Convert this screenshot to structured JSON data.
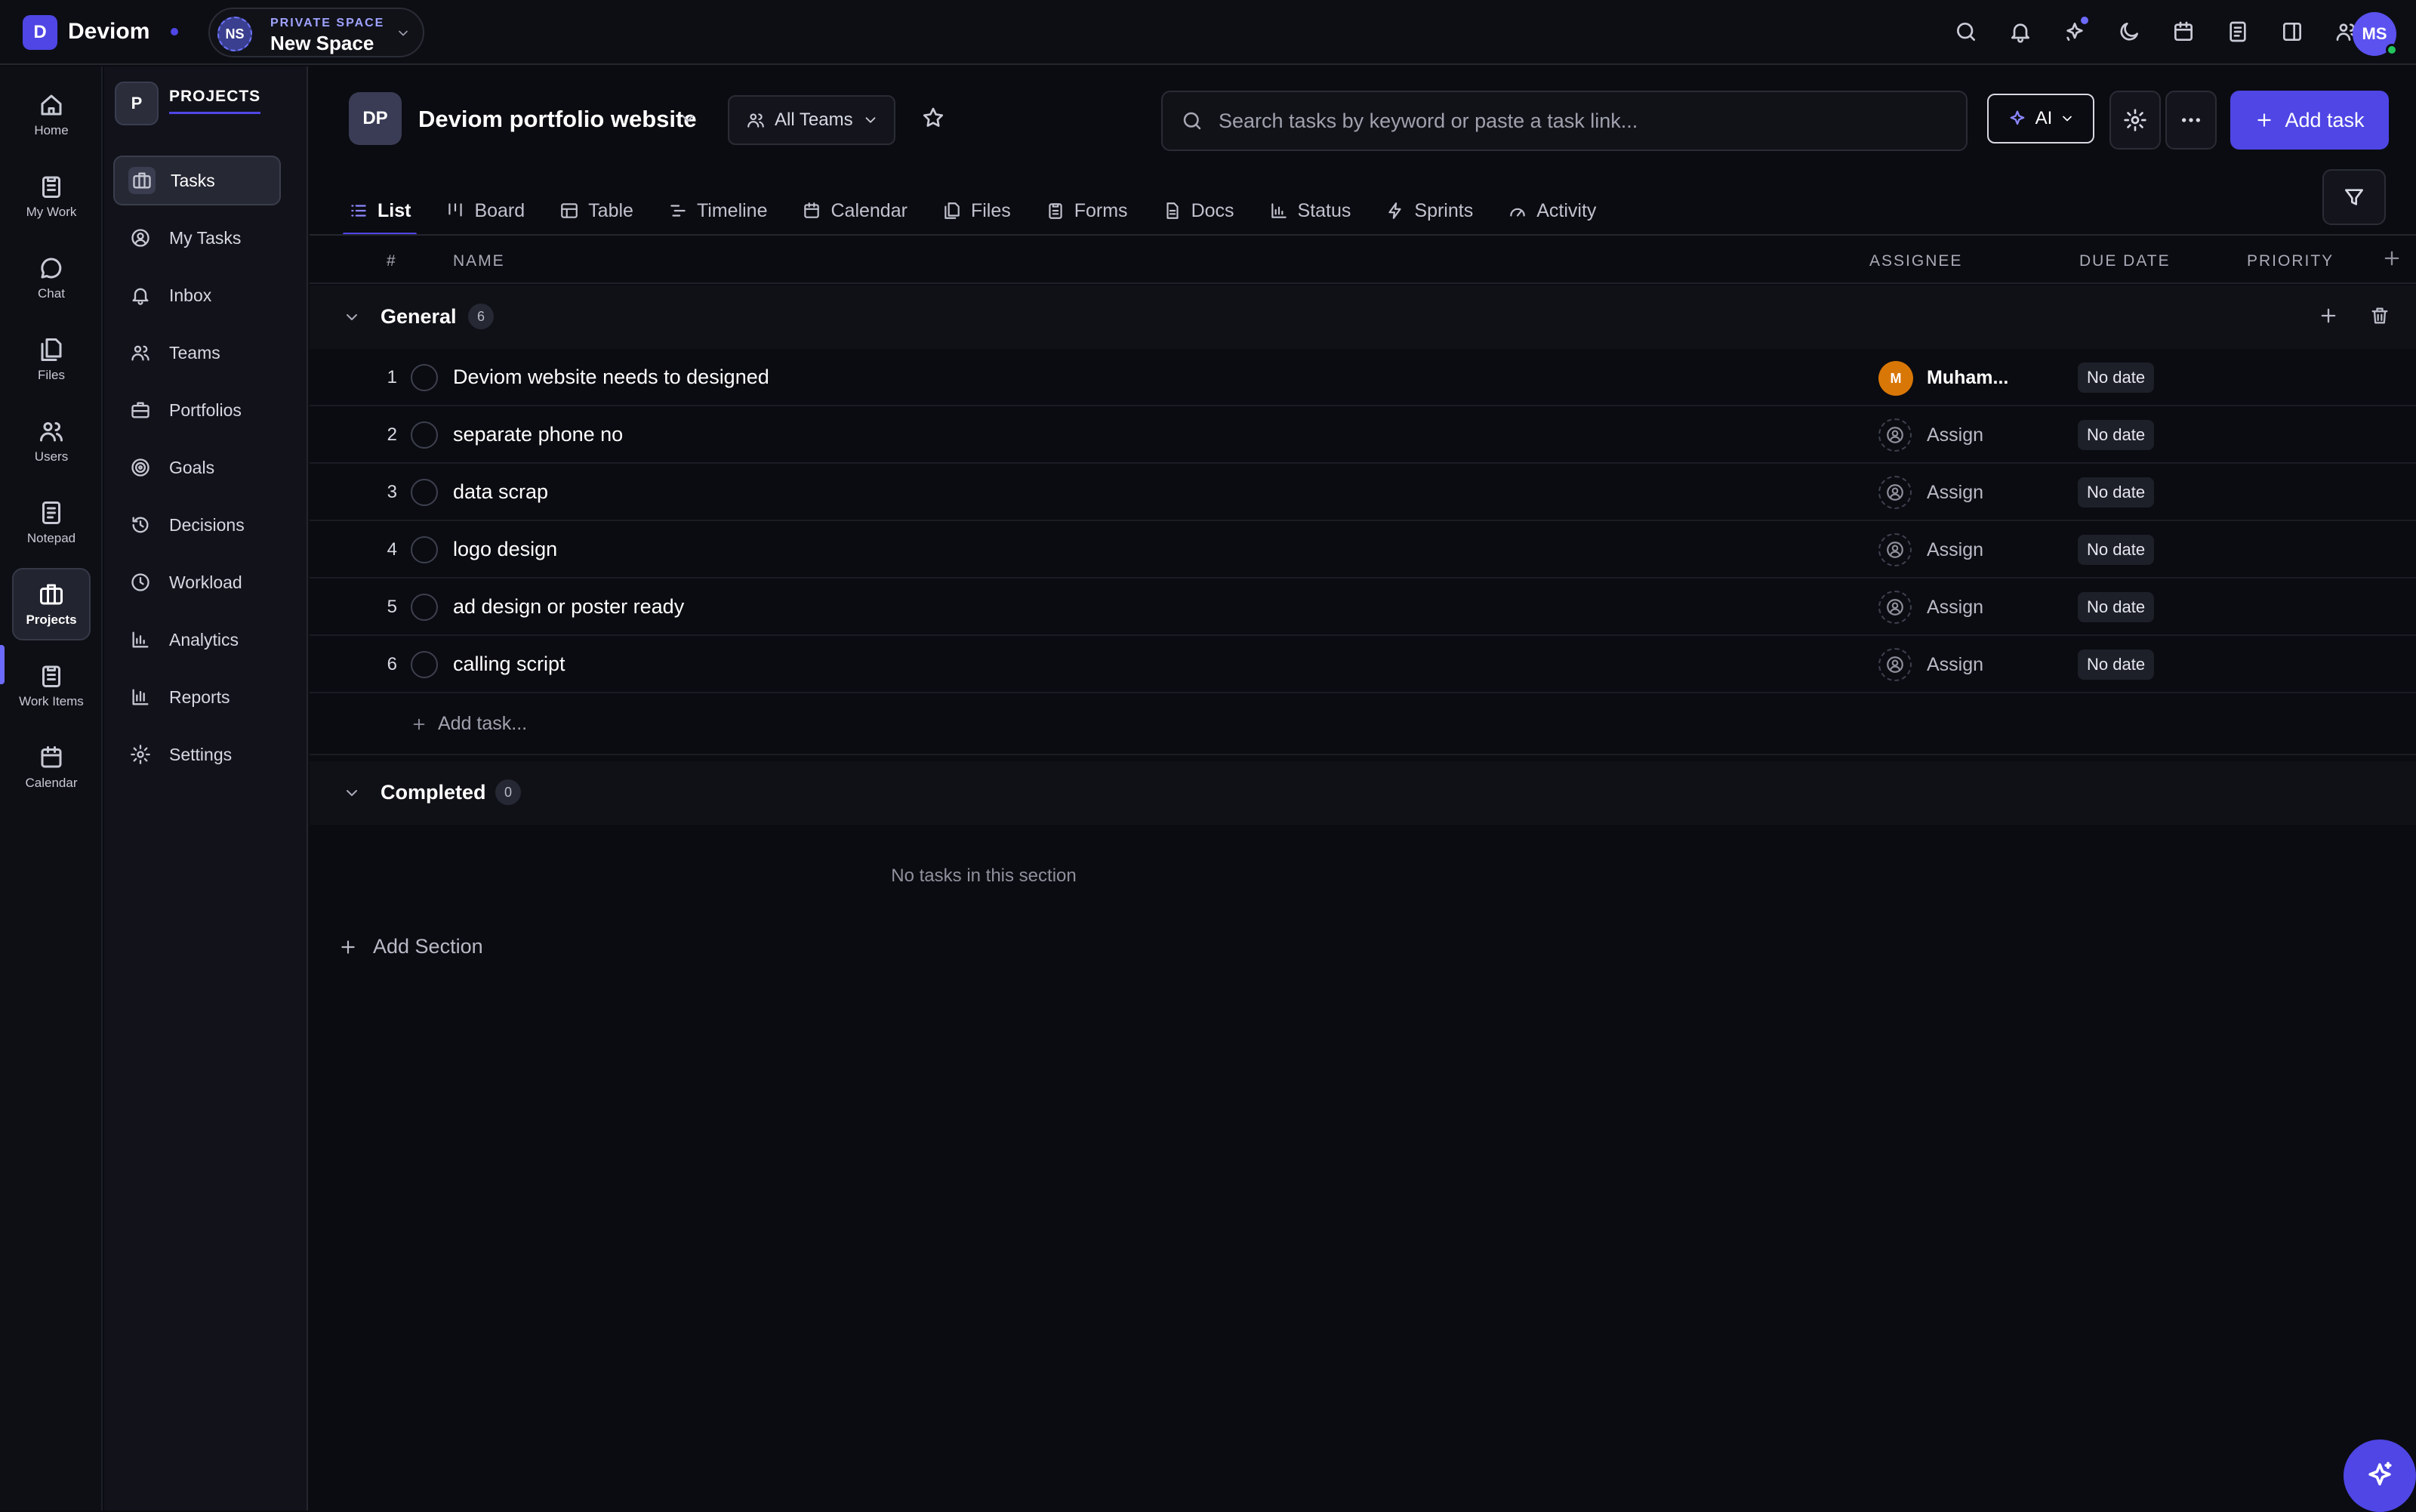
{
  "app": {
    "logo_letter": "D",
    "name": "Deviom"
  },
  "space": {
    "badge": "NS",
    "kind": "PRIVATE SPACE",
    "name": "New Space"
  },
  "user": {
    "initials": "MS"
  },
  "rail": [
    {
      "label": "Home",
      "icon": "home-icon"
    },
    {
      "label": "My Work",
      "icon": "clipboard-icon"
    },
    {
      "label": "Chat",
      "icon": "chat-icon"
    },
    {
      "label": "Files",
      "icon": "files-icon"
    },
    {
      "label": "Users",
      "icon": "users-icon"
    },
    {
      "label": "Notepad",
      "icon": "notepad-icon"
    },
    {
      "label": "Projects",
      "icon": "briefcase-icon",
      "active": true
    },
    {
      "label": "Work Items",
      "icon": "clipboard-list-icon"
    },
    {
      "label": "Calendar",
      "icon": "calendar-icon"
    }
  ],
  "sidebar": {
    "badge": "P",
    "title": "PROJECTS",
    "items": [
      {
        "label": "Tasks",
        "active": true
      },
      {
        "label": "My Tasks"
      },
      {
        "label": "Inbox"
      },
      {
        "label": "Teams"
      },
      {
        "label": "Portfolios"
      },
      {
        "label": "Goals"
      },
      {
        "label": "Decisions"
      },
      {
        "label": "Workload"
      },
      {
        "label": "Analytics"
      },
      {
        "label": "Reports"
      },
      {
        "label": "Settings"
      }
    ]
  },
  "project": {
    "badge": "DP",
    "name": "Deviom portfolio website",
    "teams_label": "All Teams"
  },
  "search": {
    "placeholder": "Search tasks by keyword or paste a task link..."
  },
  "toolbar": {
    "ai_label": "AI",
    "add_task_label": "Add task"
  },
  "tabs": [
    "List",
    "Board",
    "Table",
    "Timeline",
    "Calendar",
    "Files",
    "Forms",
    "Docs",
    "Status",
    "Sprints",
    "Activity"
  ],
  "table": {
    "headers": {
      "num": "#",
      "name": "NAME",
      "assignee": "ASSIGNEE",
      "due": "DUE DATE",
      "priority": "PRIORITY"
    },
    "sections": [
      {
        "title": "General",
        "count": "6"
      },
      {
        "title": "Completed",
        "count": "0",
        "empty_text": "No tasks in this section"
      }
    ],
    "rows": [
      {
        "num": "1",
        "name": "Deviom website needs to designed",
        "assignee_initial": "M",
        "assignee": "Muham...",
        "due": "No date"
      },
      {
        "num": "2",
        "name": "separate phone no",
        "assignee": "Assign",
        "due": "No date"
      },
      {
        "num": "3",
        "name": "data scrap",
        "assignee": "Assign",
        "due": "No date"
      },
      {
        "num": "4",
        "name": "logo design",
        "assignee": "Assign",
        "due": "No date"
      },
      {
        "num": "5",
        "name": "ad design or poster ready",
        "assignee": "Assign",
        "due": "No date"
      },
      {
        "num": "6",
        "name": "calling script",
        "assignee": "Assign",
        "due": "No date"
      }
    ],
    "add_task_label": "Add task...",
    "add_section_label": "Add Section"
  },
  "colors": {
    "accent": "#4f46e5",
    "background": "#0b0c11",
    "assignee_avatar": "#d97706"
  }
}
